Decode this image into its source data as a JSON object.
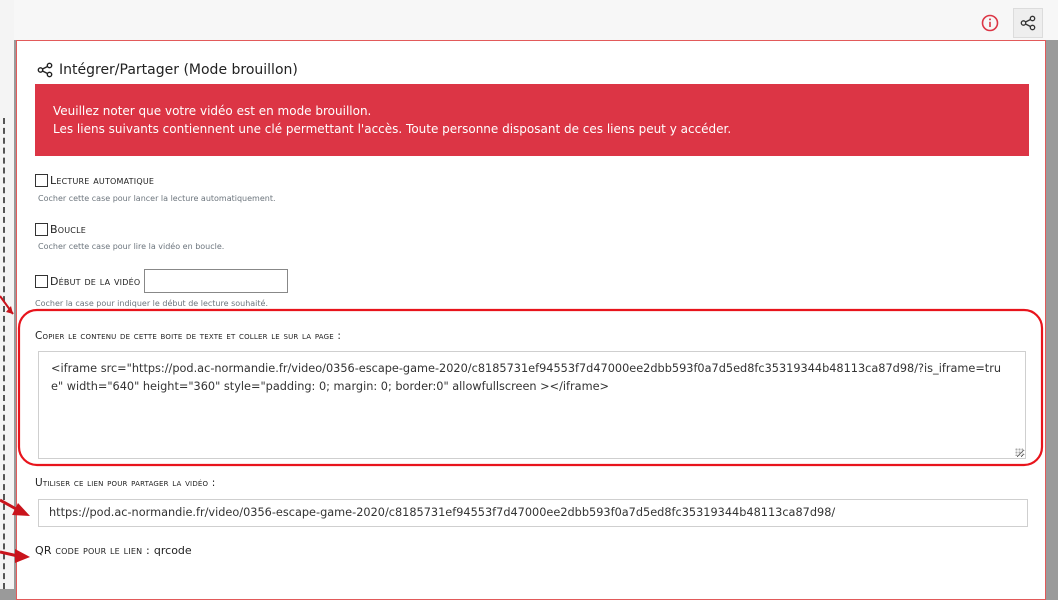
{
  "header": {
    "info_icon": "info-circle-icon",
    "share_icon": "share-icon"
  },
  "panel": {
    "title": "Intégrer/Partager (Mode brouillon)",
    "title_icon": "share-icon"
  },
  "alert": {
    "line1": "Veuillez noter que votre vidéo est en mode brouillon.",
    "line2": "Les liens suivants contiennent une clé permettant l'accès. Toute personne disposant de ces liens peut y accéder.",
    "color": "#dc3545"
  },
  "options": {
    "autoplay": {
      "label": "Lecture automatique",
      "help": "Cocher cette case pour lancer la lecture automatiquement.",
      "checked": false
    },
    "loop": {
      "label": "Boucle",
      "help": "Cocher cette case pour lire la vidéo en boucle.",
      "checked": false
    },
    "start": {
      "label": "Début de la vidéo",
      "help": "Cocher la case pour indiquer le début de lecture souhaité.",
      "checked": false,
      "value": ""
    }
  },
  "embed": {
    "label": "Copier le contenu de cette boite de texte et coller le sur la page :",
    "code": "<iframe src=\"https://pod.ac-normandie.fr/video/0356-escape-game-2020/c8185731ef94553f7d47000ee2dbb593f0a7d5ed8fc35319344b48113ca87d98/?is_iframe=true\" width=\"640\" height=\"360\" style=\"padding: 0; margin: 0; border:0\" allowfullscreen ></iframe>"
  },
  "share_link": {
    "label": "Utiliser ce lien pour partager la vidéo :",
    "url": "https://pod.ac-normandie.fr/video/0356-escape-game-2020/c8185731ef94553f7d47000ee2dbb593f0a7d5ed8fc35319344b48113ca87d98/"
  },
  "qrcode": {
    "label": "QR code pour le lien :",
    "value": "qrcode"
  },
  "colors": {
    "annotation": "#e8141c",
    "panel_border": "#e25a5a"
  }
}
